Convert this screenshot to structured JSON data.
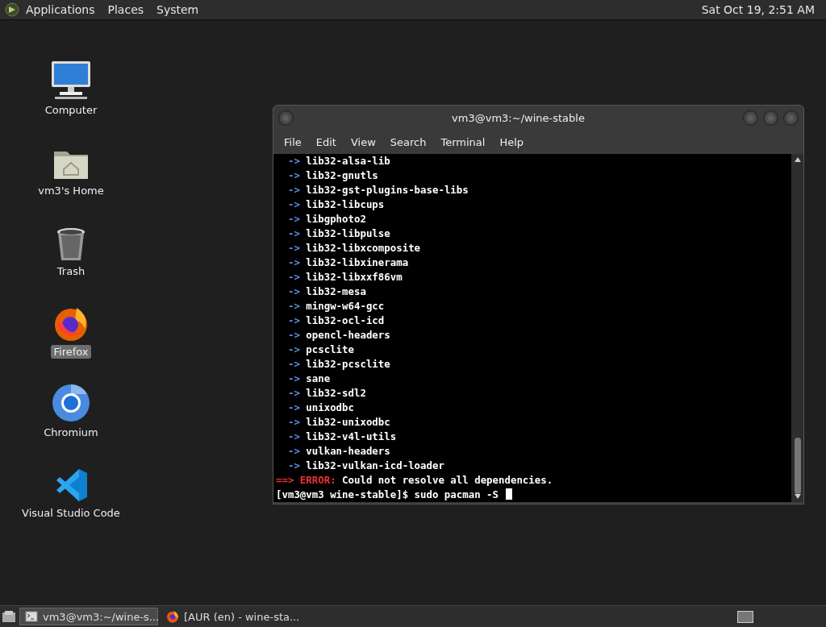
{
  "top_panel": {
    "menus": [
      "Applications",
      "Places",
      "System"
    ],
    "clock": "Sat Oct 19,  2:51 AM"
  },
  "desktop_icons": [
    {
      "kind": "computer",
      "label": "Computer",
      "selected": false
    },
    {
      "kind": "home",
      "label": "vm3's Home",
      "selected": false
    },
    {
      "kind": "trash",
      "label": "Trash",
      "selected": false
    },
    {
      "kind": "firefox",
      "label": "Firefox",
      "selected": true
    },
    {
      "kind": "chromium",
      "label": "Chromium",
      "selected": false
    },
    {
      "kind": "vscode",
      "label": "Visual Studio Code",
      "selected": false
    }
  ],
  "terminal": {
    "title": "vm3@vm3:~/wine-stable",
    "menus": [
      "File",
      "Edit",
      "View",
      "Search",
      "Terminal",
      "Help"
    ],
    "lines": [
      {
        "kind": "dep",
        "arrow": "->",
        "text": "lib32-alsa-lib"
      },
      {
        "kind": "dep",
        "arrow": "->",
        "text": "lib32-gnutls"
      },
      {
        "kind": "dep",
        "arrow": "->",
        "text": "lib32-gst-plugins-base-libs"
      },
      {
        "kind": "dep",
        "arrow": "->",
        "text": "lib32-libcups"
      },
      {
        "kind": "dep",
        "arrow": "->",
        "text": "libgphoto2"
      },
      {
        "kind": "dep",
        "arrow": "->",
        "text": "lib32-libpulse"
      },
      {
        "kind": "dep",
        "arrow": "->",
        "text": "lib32-libxcomposite"
      },
      {
        "kind": "dep",
        "arrow": "->",
        "text": "lib32-libxinerama"
      },
      {
        "kind": "dep",
        "arrow": "->",
        "text": "lib32-libxxf86vm"
      },
      {
        "kind": "dep",
        "arrow": "->",
        "text": "lib32-mesa"
      },
      {
        "kind": "dep",
        "arrow": "->",
        "text": "mingw-w64-gcc"
      },
      {
        "kind": "dep",
        "arrow": "->",
        "text": "lib32-ocl-icd"
      },
      {
        "kind": "dep",
        "arrow": "->",
        "text": "opencl-headers"
      },
      {
        "kind": "dep",
        "arrow": "->",
        "text": "pcsclite"
      },
      {
        "kind": "dep",
        "arrow": "->",
        "text": "lib32-pcsclite"
      },
      {
        "kind": "dep",
        "arrow": "->",
        "text": "sane"
      },
      {
        "kind": "dep",
        "arrow": "->",
        "text": "lib32-sdl2"
      },
      {
        "kind": "dep",
        "arrow": "->",
        "text": "unixodbc"
      },
      {
        "kind": "dep",
        "arrow": "->",
        "text": "lib32-unixodbc"
      },
      {
        "kind": "dep",
        "arrow": "->",
        "text": "lib32-v4l-utils"
      },
      {
        "kind": "dep",
        "arrow": "->",
        "text": "vulkan-headers"
      },
      {
        "kind": "dep",
        "arrow": "->",
        "text": "lib32-vulkan-icd-loader"
      },
      {
        "kind": "error",
        "arrow": "==>",
        "label": "ERROR:",
        "text": "Could not resolve all dependencies."
      },
      {
        "kind": "prompt",
        "text": "[vm3@vm3 wine-stable]$ sudo pacman -S"
      }
    ]
  },
  "taskbar": {
    "items": [
      {
        "kind": "terminal",
        "label": "vm3@vm3:~/wine-s...",
        "selected": true
      },
      {
        "kind": "firefox",
        "label": "[AUR (en) - wine-sta...",
        "selected": false
      }
    ]
  }
}
